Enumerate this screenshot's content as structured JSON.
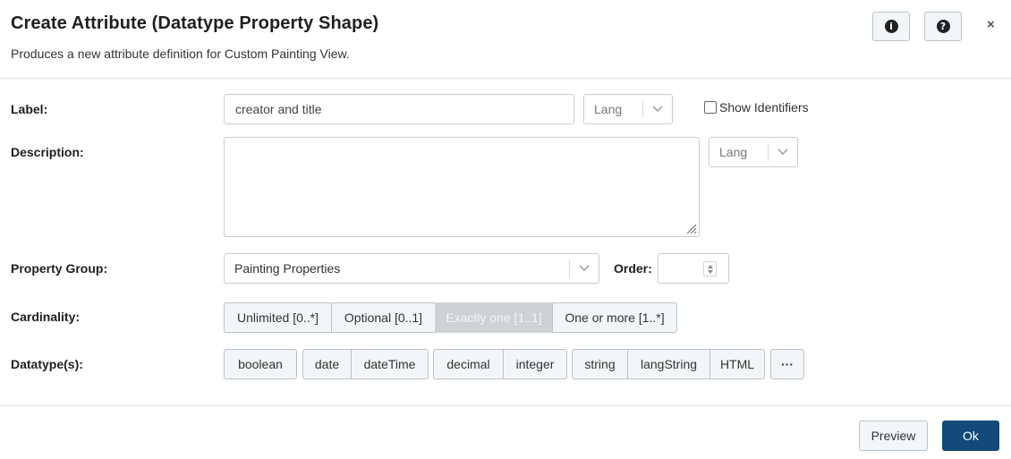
{
  "dialog": {
    "title": "Create Attribute (Datatype Property Shape)",
    "subtitle": "Produces a new attribute definition for Custom Painting View.",
    "info_icon": "info-circle-icon",
    "help_icon": "question-circle-icon",
    "close_glyph": "×"
  },
  "form": {
    "label": {
      "text": "Label:",
      "value": "creator and title",
      "lang_placeholder": "Lang"
    },
    "show_identifiers": {
      "text": "Show Identifiers",
      "checked": false
    },
    "description": {
      "text": "Description:",
      "value": "",
      "lang_placeholder": "Lang"
    },
    "property_group": {
      "text": "Property Group:",
      "value": "Painting Properties"
    },
    "order": {
      "text": "Order:",
      "value": ""
    },
    "cardinality": {
      "text": "Cardinality:",
      "options": [
        "Unlimited [0..*]",
        "Optional [0..1]",
        "Exactly one [1..1]",
        "One or more [1..*]"
      ],
      "selected": "Exactly one [1..1]"
    },
    "datatypes": {
      "text": "Datatype(s):",
      "groups": [
        [
          "boolean"
        ],
        [
          "date",
          "dateTime"
        ],
        [
          "decimal",
          "integer"
        ],
        [
          "string",
          "langString",
          "HTML"
        ],
        [
          "···"
        ]
      ]
    }
  },
  "footer": {
    "preview_label": "Preview",
    "ok_label": "Ok"
  },
  "colors": {
    "primary": "#124a79",
    "button_bg": "#f3f6f8",
    "active_segment": "#cfd2d4"
  }
}
